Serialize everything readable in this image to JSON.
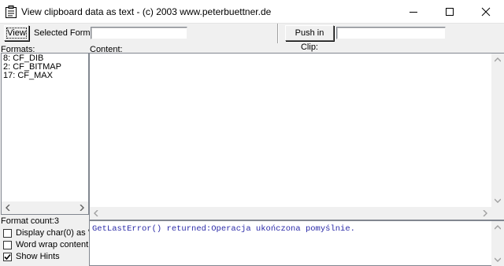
{
  "window": {
    "title": "View clipboard data as text - (c) 2003 www.peterbuettner.de"
  },
  "toolbar": {
    "view_label": "View",
    "selected_format_label": "Selected Format:",
    "selected_format_value": "",
    "push_label": "Push in Clip:",
    "push_value": ""
  },
  "formats": {
    "label": "Formats:",
    "items": [
      "8: CF_DIB",
      "2: CF_BITMAP",
      "17: CF_MAX"
    ],
    "count_label": "Format count:3"
  },
  "content": {
    "label": "Content:",
    "text": ""
  },
  "status": {
    "text": "GetLastError() returned:Operacja ukończona pomyślnie.",
    "color": "#2a2aa8"
  },
  "options": [
    {
      "label": "Display char(0) as '#'",
      "checked": false
    },
    {
      "label": "Word wrap content",
      "checked": false
    },
    {
      "label": "Show Hints",
      "checked": true
    }
  ]
}
